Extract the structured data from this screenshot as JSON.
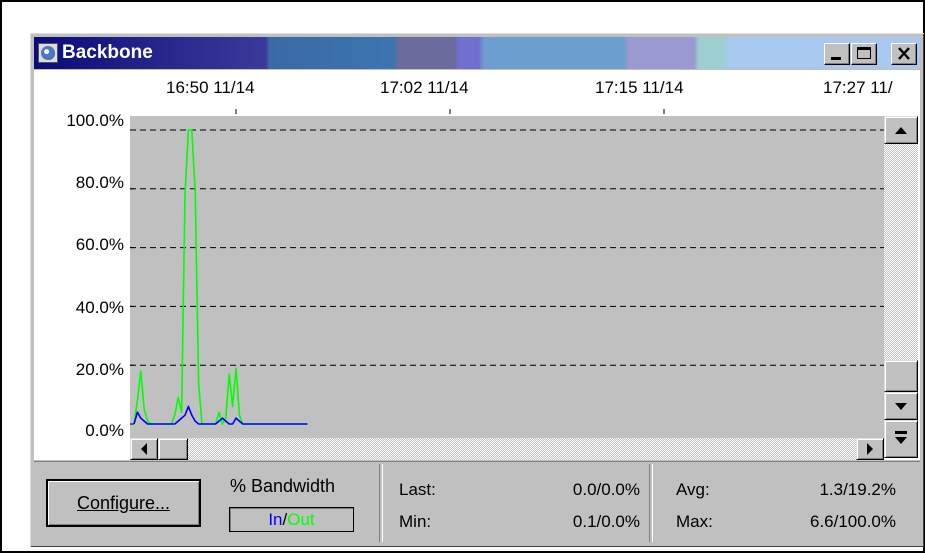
{
  "window": {
    "title": "Backbone",
    "controls": {
      "minimize_icon": "minimize-icon",
      "maximize_icon": "maximize-icon",
      "close_icon": "close-icon"
    }
  },
  "time_axis": {
    "labels": [
      "16:50 11/14",
      "17:02 11/14",
      "17:15 11/14",
      "17:27 11/"
    ]
  },
  "chart_data": {
    "type": "line",
    "y_ticks": [
      "100.0%",
      "80.0%",
      "60.0%",
      "40.0%",
      "20.0%",
      "0.0%"
    ],
    "ylim": [
      0,
      100
    ],
    "grid": true,
    "background": "#c0c0c0",
    "series": [
      {
        "name": "In",
        "color": "#0000ff",
        "values": [
          0,
          4,
          2,
          1,
          0,
          0,
          0,
          0,
          0,
          0,
          0,
          0,
          0,
          1,
          2,
          3,
          6,
          3,
          1,
          0,
          0,
          0,
          0,
          0,
          0,
          1,
          2,
          1,
          0,
          0,
          2,
          1,
          0,
          0,
          0,
          0,
          0,
          0,
          0,
          0,
          0,
          0,
          0,
          0,
          0,
          0,
          0,
          0,
          0,
          0,
          0,
          0
        ]
      },
      {
        "name": "Out",
        "color": "#00ff00",
        "values": [
          0,
          8,
          18,
          5,
          1,
          0,
          0,
          0,
          0,
          0,
          0,
          0,
          3,
          9,
          4,
          78,
          100,
          100,
          79,
          14,
          0,
          0,
          0,
          0,
          0,
          4,
          0,
          2,
          17,
          6,
          19,
          3,
          0,
          0,
          0,
          0,
          0,
          0,
          0,
          0,
          0,
          0,
          0,
          0,
          0,
          0,
          0,
          0,
          0,
          0,
          0,
          0
        ]
      }
    ]
  },
  "status": {
    "configure_label": "Configure...",
    "bandwidth_label": "% Bandwidth",
    "in_label": "In",
    "slash": "/",
    "out_label": "Out",
    "in_color": "#0000ff",
    "out_color": "#00ff00",
    "last_label": "Last:",
    "last_value": "0.0/0.0%",
    "min_label": "Min:",
    "min_value": "0.1/0.0%",
    "avg_label": "Avg:",
    "avg_value": "1.3/19.2%",
    "max_label": "Max:",
    "max_value": "6.6/100.0%"
  }
}
